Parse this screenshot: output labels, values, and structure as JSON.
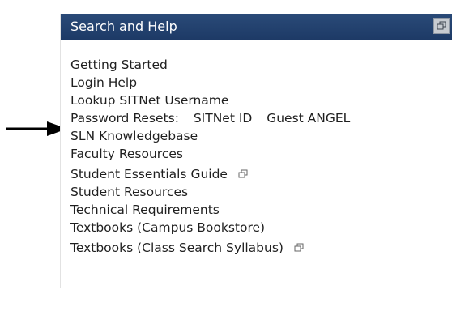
{
  "panel": {
    "title": "Search and Help"
  },
  "links": {
    "getting_started": "Getting Started",
    "login_help": "Login Help",
    "lookup_username": "Lookup SITNet Username",
    "password_prefix": "Password Resets:",
    "password_sitnet": "SITNet ID",
    "password_guest": "Guest ANGEL",
    "sln_knowledgebase": "SLN Knowledgebase",
    "faculty_resources": "Faculty Resources",
    "student_essentials": "Student Essentials Guide",
    "student_resources": "Student Resources",
    "technical_requirements": "Technical Requirements",
    "textbooks_campus": "Textbooks (Campus Bookstore)",
    "textbooks_class_search": "Textbooks (Class Search Syllabus)"
  },
  "icons": {
    "header": "restore-window-icon",
    "external": "popup-window-icon",
    "pointer": "right-arrow-icon"
  },
  "colors": {
    "header_bg": "#1d3a66",
    "text": "#1f1f1f"
  }
}
